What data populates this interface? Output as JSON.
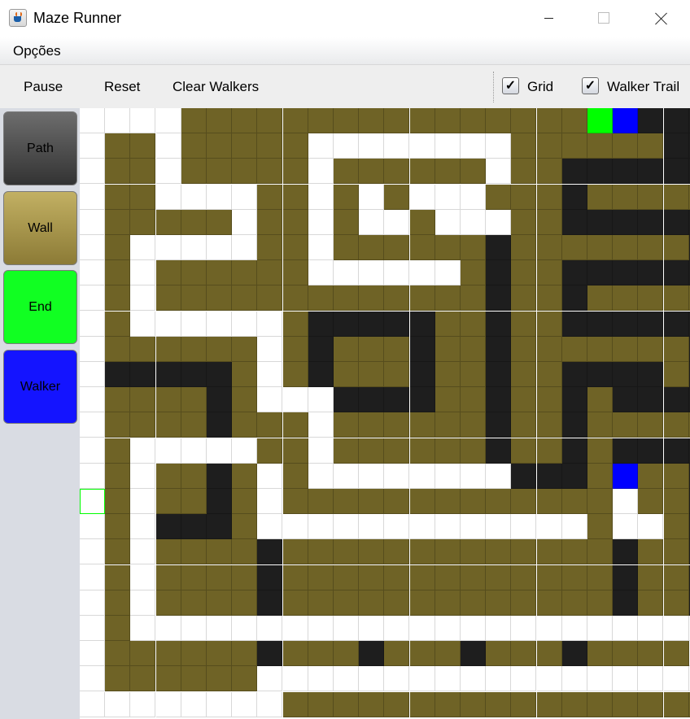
{
  "window": {
    "title": "Maze Runner"
  },
  "menu": {
    "items": [
      "Opções"
    ]
  },
  "toolbar": {
    "pause_label": "Pause",
    "reset_label": "Reset",
    "clear_walkers_label": "Clear Walkers",
    "grid_label": "Grid",
    "grid_checked": true,
    "walker_trail_label": "Walker Trail",
    "walker_trail_checked": true,
    "check_glyph": "✓"
  },
  "palette": {
    "path_label": "Path",
    "wall_label": "Wall",
    "end_label": "End",
    "walker_label": "Walker"
  },
  "colors": {
    "path": "#ffffff",
    "wall": "#6f6326",
    "trail": "#1e1e1e",
    "end": "#00ff00",
    "walker": "#0000ff"
  },
  "maze": {
    "legend": {
      ".": "path",
      "W": "wall",
      "T": "walker-trail",
      "E": "end",
      "B": "walker",
      "o": "start-outline"
    },
    "rows": [
      "....WWWWWWWWWWWWWWWWEBTTT",
      ".WW.WWWWW........WWWWWWTT",
      ".WW.WWWWW.WWWWWW.WWTTTTTT",
      ".WW....WW.W.W...WWWTWWWWW",
      ".WWWWW.WW.W..W...WWTTTTTT",
      ".W.....WW.WWWWWWTWWWWWWWT",
      ".W.WWWWWW......WTWWTTTTTT",
      ".W.WWWWWWWWWWWWWTWWTWWWWW",
      ".W......WTTTTTWWTWWTTTTTT",
      ".WWWWWW.WTWWWTWWTWWWWWWWT",
      ".TTTTTW.WTWWWTWWTWWTTTTWT",
      ".WWWWTW...TTTTWWTWWTWTTTT",
      ".WWWWTWWW.WWWWWWTWWTWWWWW",
      ".W.....WW.WWWWWWTWWTWTTTT",
      ".W.WWTW.W........TTTWBWWT",
      "oW.WWTW.WWWWWWWWWWWWW.WWT",
      ".W.TTTW.............W..WT",
      ".W.WWWWTWWWWWWWWWWWWWTWWT",
      ".W.WWWWTWWWWWWWWWWWWWTWWT",
      ".W.WWWWTWWWWWWWWWWWWWTWWT",
      ".W.......................",
      ".WWWWWWTWWWTWWWTWWWTWWWW.",
      ".WWWWWW..................",
      "........WWWWWWWWWWWWWWWWW"
    ]
  }
}
